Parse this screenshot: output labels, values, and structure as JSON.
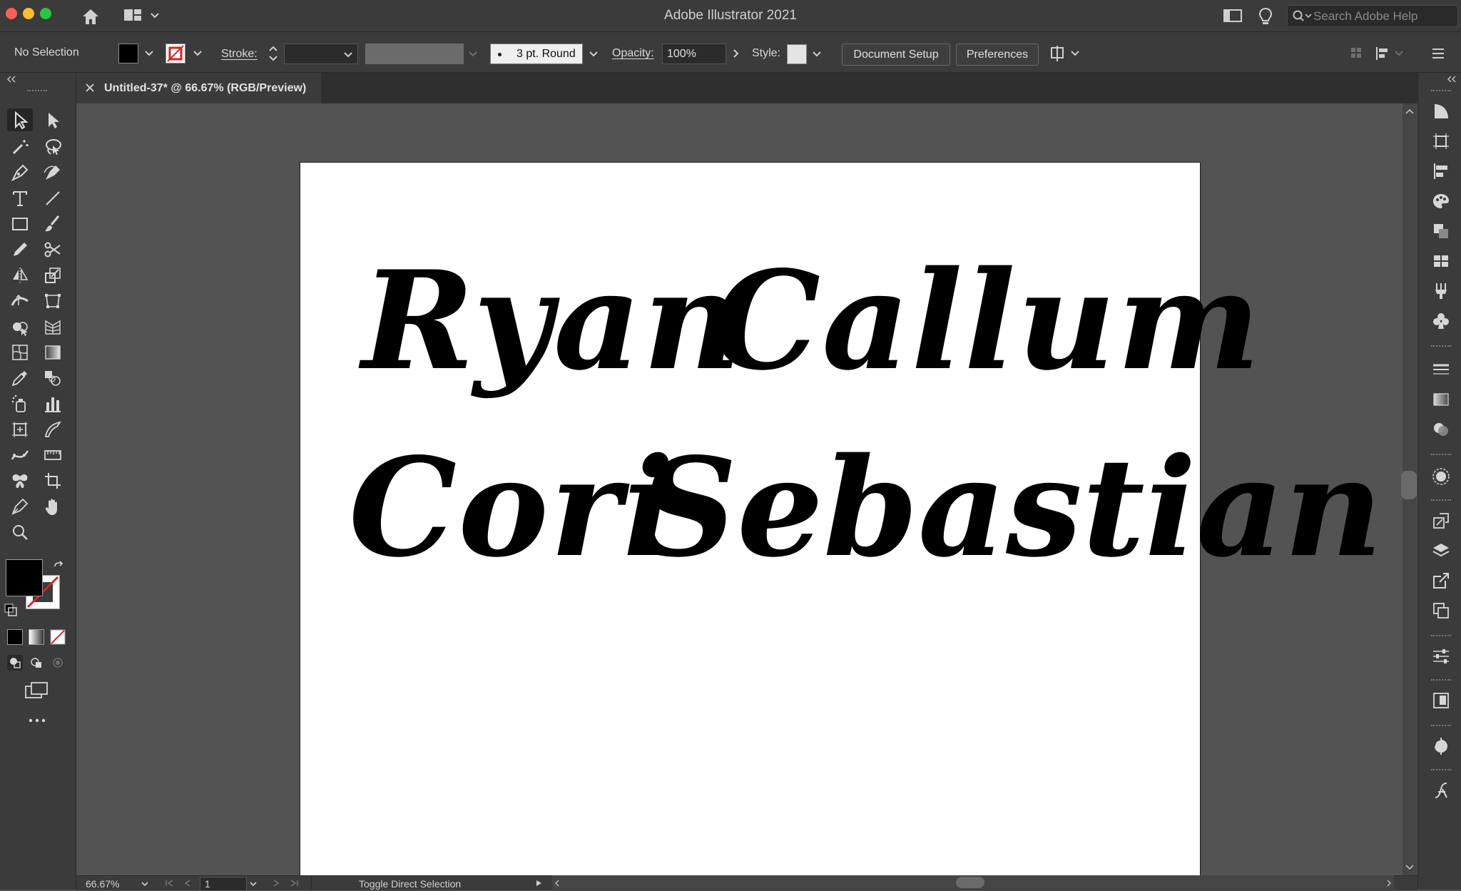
{
  "app": {
    "title": "Adobe Illustrator 2021",
    "search_placeholder": "Search Adobe Help"
  },
  "control_bar": {
    "selection_label": "No Selection",
    "stroke_label": "Stroke:",
    "brush_label": "3 pt. Round",
    "opacity_label": "Opacity:",
    "opacity_value": "100%",
    "style_label": "Style:",
    "document_setup": "Document Setup",
    "preferences": "Preferences"
  },
  "document_tab": {
    "title": "Untitled-37* @ 66.67% (RGB/Preview)"
  },
  "artboard": {
    "lines": [
      [
        "Ryan",
        "Callum"
      ],
      [
        "Cori",
        "Sebastian"
      ]
    ]
  },
  "status_bar": {
    "zoom": "66.67%",
    "artboard_number": "1",
    "tool_status": "Toggle Direct Selection"
  },
  "colors": {
    "fill": "#000000",
    "stroke": "none",
    "ui_background": "#535353",
    "panel": "#3b3b3b"
  }
}
